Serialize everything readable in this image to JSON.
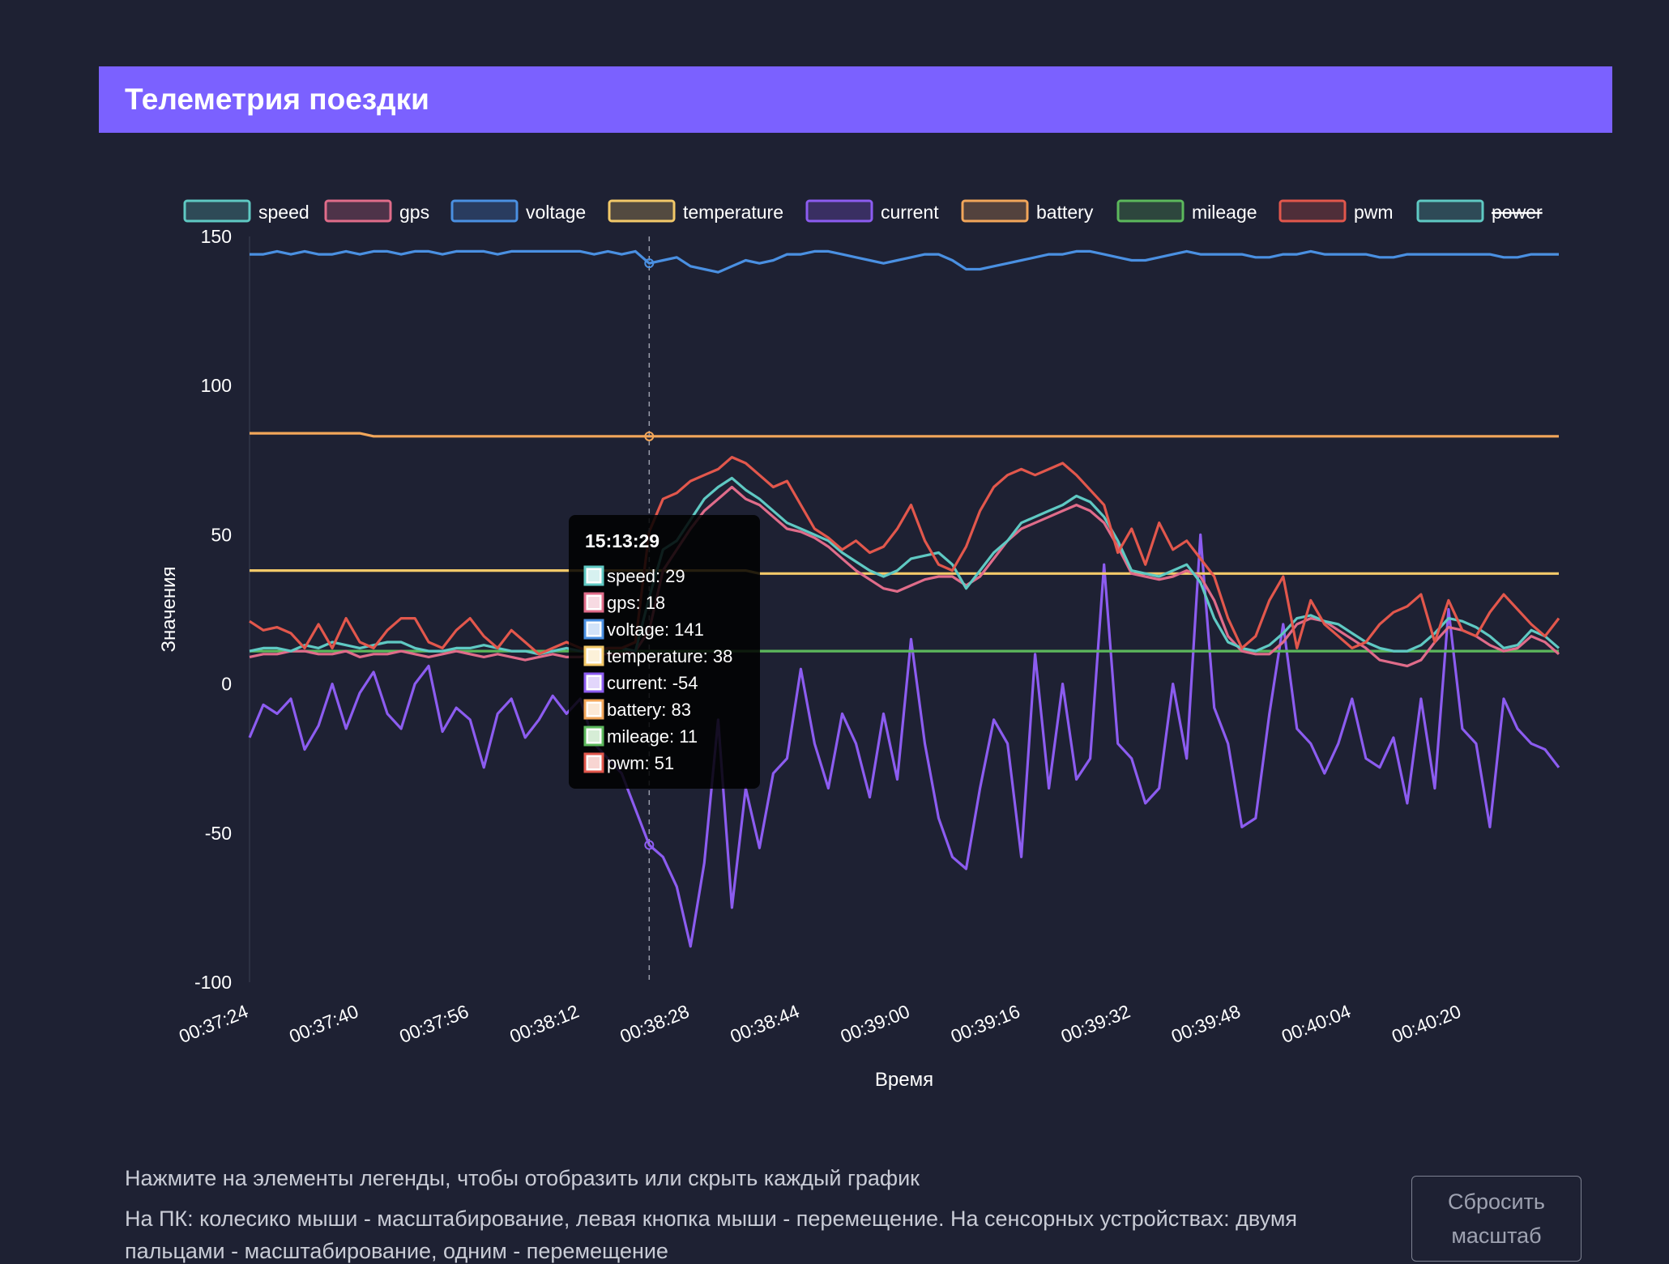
{
  "header": {
    "title": "Телеметрия поездки"
  },
  "hints": {
    "line1": "Нажмите на элементы легенды, чтобы отобразить или скрыть каждый график",
    "line2": "На ПК: колесико мыши - масштабирование, левая кнопка мыши - перемещение. На сенсорных устройствах: двумя",
    "line3": "пальцами - масштабирование, одним - перемещение"
  },
  "reset_button": {
    "label": "Сбросить масштаб"
  },
  "tooltip": {
    "time": "15:13:29",
    "rows": [
      {
        "series": "speed",
        "text": "speed: 29"
      },
      {
        "series": "gps",
        "text": "gps: 18"
      },
      {
        "series": "voltage",
        "text": "voltage: 141"
      },
      {
        "series": "temperature",
        "text": "temperature: 38"
      },
      {
        "series": "current",
        "text": "current: -54"
      },
      {
        "series": "battery",
        "text": "battery: 83"
      },
      {
        "series": "mileage",
        "text": "mileage: 11"
      },
      {
        "series": "pwm",
        "text": "pwm: 51"
      }
    ]
  },
  "chart_data": {
    "type": "line",
    "xlabel": "Время",
    "ylabel": "Значения",
    "ylim": [
      -100,
      150
    ],
    "yticks": [
      150,
      100,
      50,
      0,
      -50,
      -100
    ],
    "xlim": [
      "00:37:24",
      "00:40:34"
    ],
    "xticks": [
      "00:37:24",
      "00:37:40",
      "00:37:56",
      "00:38:12",
      "00:38:28",
      "00:38:44",
      "00:39:00",
      "00:39:16",
      "00:39:32",
      "00:39:48",
      "00:40:04",
      "00:40:20"
    ],
    "grid": false,
    "legend_position": "top",
    "hover_time": "00:38:22",
    "x": [
      "00:37:24",
      "00:37:26",
      "00:37:28",
      "00:37:30",
      "00:37:32",
      "00:37:34",
      "00:37:36",
      "00:37:38",
      "00:37:40",
      "00:37:42",
      "00:37:44",
      "00:37:46",
      "00:37:48",
      "00:37:50",
      "00:37:52",
      "00:37:54",
      "00:37:56",
      "00:37:58",
      "00:38:00",
      "00:38:02",
      "00:38:04",
      "00:38:06",
      "00:38:08",
      "00:38:10",
      "00:38:12",
      "00:38:14",
      "00:38:16",
      "00:38:18",
      "00:38:20",
      "00:38:22",
      "00:38:24",
      "00:38:26",
      "00:38:28",
      "00:38:30",
      "00:38:32",
      "00:38:34",
      "00:38:36",
      "00:38:38",
      "00:38:40",
      "00:38:42",
      "00:38:44",
      "00:38:46",
      "00:38:48",
      "00:38:50",
      "00:38:52",
      "00:38:54",
      "00:38:56",
      "00:38:58",
      "00:39:00",
      "00:39:02",
      "00:39:04",
      "00:39:06",
      "00:39:08",
      "00:39:10",
      "00:39:12",
      "00:39:14",
      "00:39:16",
      "00:39:18",
      "00:39:20",
      "00:39:22",
      "00:39:24",
      "00:39:26",
      "00:39:28",
      "00:39:30",
      "00:39:32",
      "00:39:34",
      "00:39:36",
      "00:39:38",
      "00:39:40",
      "00:39:42",
      "00:39:44",
      "00:39:46",
      "00:39:48",
      "00:39:50",
      "00:39:52",
      "00:39:54",
      "00:39:56",
      "00:39:58",
      "00:40:00",
      "00:40:02",
      "00:40:04",
      "00:40:06",
      "00:40:08",
      "00:40:10",
      "00:40:12",
      "00:40:14",
      "00:40:16",
      "00:40:18",
      "00:40:20",
      "00:40:22",
      "00:40:24",
      "00:40:26",
      "00:40:28",
      "00:40:30",
      "00:40:32",
      "00:40:34"
    ],
    "series": [
      {
        "name": "speed",
        "color": "#5fc9c3",
        "fill": "rgba(95,201,195,0.25)",
        "hidden": false,
        "values": [
          11,
          12,
          12,
          11,
          13,
          12,
          14,
          13,
          12,
          13,
          14,
          14,
          12,
          11,
          11,
          12,
          12,
          13,
          12,
          11,
          11,
          10,
          11,
          12,
          11,
          11,
          12,
          12,
          11,
          29,
          45,
          48,
          55,
          62,
          66,
          69,
          65,
          62,
          58,
          54,
          52,
          50,
          48,
          44,
          41,
          38,
          36,
          38,
          42,
          43,
          44,
          40,
          32,
          38,
          44,
          48,
          54,
          56,
          58,
          60,
          63,
          61,
          56,
          48,
          38,
          37,
          36,
          38,
          40,
          34,
          22,
          14,
          12,
          11,
          13,
          17,
          22,
          23,
          21,
          20,
          17,
          14,
          12,
          11,
          11,
          13,
          17,
          22,
          21,
          19,
          16,
          12,
          13,
          18,
          16,
          12
        ]
      },
      {
        "name": "gps",
        "color": "#e06c8a",
        "fill": "rgba(224,108,138,0.25)",
        "hidden": false,
        "values": [
          9,
          10,
          10,
          11,
          11,
          10,
          10,
          11,
          9,
          10,
          10,
          11,
          10,
          9,
          10,
          11,
          10,
          9,
          10,
          9,
          8,
          9,
          10,
          9,
          9,
          10,
          10,
          10,
          11,
          18,
          38,
          45,
          52,
          58,
          62,
          66,
          62,
          60,
          56,
          52,
          51,
          49,
          46,
          42,
          38,
          35,
          32,
          31,
          33,
          35,
          36,
          36,
          33,
          36,
          42,
          48,
          52,
          54,
          56,
          58,
          60,
          58,
          54,
          46,
          37,
          36,
          35,
          36,
          38,
          36,
          28,
          16,
          11,
          10,
          10,
          14,
          20,
          22,
          21,
          18,
          15,
          12,
          8,
          7,
          6,
          8,
          14,
          19,
          18,
          16,
          13,
          11,
          12,
          16,
          14,
          10
        ]
      },
      {
        "name": "voltage",
        "color": "#4a90e2",
        "fill": "rgba(74,144,226,0.25)",
        "hidden": false,
        "values": [
          144,
          144,
          145,
          144,
          145,
          144,
          144,
          145,
          144,
          145,
          145,
          144,
          145,
          145,
          144,
          145,
          145,
          145,
          144,
          145,
          145,
          145,
          145,
          145,
          145,
          144,
          145,
          144,
          145,
          141,
          142,
          143,
          140,
          139,
          138,
          140,
          142,
          141,
          142,
          144,
          144,
          145,
          145,
          144,
          143,
          142,
          141,
          142,
          143,
          144,
          144,
          142,
          139,
          139,
          140,
          141,
          142,
          143,
          144,
          144,
          145,
          145,
          144,
          143,
          142,
          142,
          143,
          144,
          145,
          144,
          144,
          144,
          144,
          143,
          143,
          144,
          144,
          145,
          144,
          144,
          144,
          144,
          143,
          143,
          144,
          144,
          144,
          144,
          144,
          144,
          144,
          143,
          143,
          144,
          144,
          144
        ]
      },
      {
        "name": "temperature",
        "color": "#f3c969",
        "fill": "rgba(243,201,105,0.25)",
        "hidden": false,
        "values": [
          38,
          38,
          38,
          38,
          38,
          38,
          38,
          38,
          38,
          38,
          38,
          38,
          38,
          38,
          38,
          38,
          38,
          38,
          38,
          38,
          38,
          38,
          38,
          38,
          38,
          38,
          38,
          38,
          38,
          38,
          38,
          38,
          38,
          38,
          38,
          38,
          38,
          37,
          37,
          37,
          37,
          37,
          37,
          37,
          37,
          37,
          37,
          37,
          37,
          37,
          37,
          37,
          37,
          37,
          37,
          37,
          37,
          37,
          37,
          37,
          37,
          37,
          37,
          37,
          37,
          37,
          37,
          37,
          37,
          37,
          37,
          37,
          37,
          37,
          37,
          37,
          37,
          37,
          37,
          37,
          37,
          37,
          37,
          37,
          37,
          37,
          37,
          37,
          37,
          37,
          37,
          37,
          37,
          37,
          37,
          37
        ]
      },
      {
        "name": "current",
        "color": "#8c5cf0",
        "fill": "rgba(140,92,240,0.25)",
        "hidden": false,
        "values": [
          -18,
          -7,
          -10,
          -5,
          -22,
          -14,
          0,
          -15,
          -3,
          4,
          -10,
          -15,
          0,
          6,
          -16,
          -8,
          -12,
          -28,
          -10,
          -5,
          -18,
          -12,
          -4,
          -10,
          -5,
          -20,
          -25,
          -30,
          -42,
          -54,
          -58,
          -68,
          -88,
          -60,
          -12,
          -75,
          -35,
          -55,
          -30,
          -25,
          5,
          -20,
          -35,
          -10,
          -20,
          -38,
          -10,
          -32,
          15,
          -20,
          -45,
          -58,
          -62,
          -35,
          -12,
          -20,
          -58,
          10,
          -35,
          0,
          -32,
          -25,
          40,
          -20,
          -25,
          -40,
          -35,
          0,
          -25,
          50,
          -8,
          -20,
          -48,
          -45,
          -10,
          20,
          -15,
          -20,
          -30,
          -20,
          -5,
          -25,
          -28,
          -18,
          -40,
          -5,
          -35,
          25,
          -15,
          -20,
          -48,
          -5,
          -15,
          -20,
          -22,
          -28
        ]
      },
      {
        "name": "battery",
        "color": "#f2a65a",
        "fill": "rgba(242,166,90,0.25)",
        "hidden": false,
        "values": [
          84,
          84,
          84,
          84,
          84,
          84,
          84,
          84,
          84,
          83,
          83,
          83,
          83,
          83,
          83,
          83,
          83,
          83,
          83,
          83,
          83,
          83,
          83,
          83,
          83,
          83,
          83,
          83,
          83,
          83,
          83,
          83,
          83,
          83,
          83,
          83,
          83,
          83,
          83,
          83,
          83,
          83,
          83,
          83,
          83,
          83,
          83,
          83,
          83,
          83,
          83,
          83,
          83,
          83,
          83,
          83,
          83,
          83,
          83,
          83,
          83,
          83,
          83,
          83,
          83,
          83,
          83,
          83,
          83,
          83,
          83,
          83,
          83,
          83,
          83,
          83,
          83,
          83,
          83,
          83,
          83,
          83,
          83,
          83,
          83,
          83,
          83,
          83,
          83,
          83,
          83,
          83,
          83,
          83,
          83,
          83
        ]
      },
      {
        "name": "mileage",
        "color": "#5cb85c",
        "fill": "rgba(92,184,92,0.25)",
        "hidden": false,
        "values": [
          11,
          11,
          11,
          11,
          11,
          11,
          11,
          11,
          11,
          11,
          11,
          11,
          11,
          11,
          11,
          11,
          11,
          11,
          11,
          11,
          11,
          11,
          11,
          11,
          11,
          11,
          11,
          11,
          11,
          11,
          11,
          11,
          11,
          11,
          11,
          11,
          11,
          11,
          11,
          11,
          11,
          11,
          11,
          11,
          11,
          11,
          11,
          11,
          11,
          11,
          11,
          11,
          11,
          11,
          11,
          11,
          11,
          11,
          11,
          11,
          11,
          11,
          11,
          11,
          11,
          11,
          11,
          11,
          11,
          11,
          11,
          11,
          11,
          11,
          11,
          11,
          11,
          11,
          11,
          11,
          11,
          11,
          11,
          11,
          11,
          11,
          11,
          11,
          11,
          11,
          11,
          11,
          11,
          11,
          11,
          11
        ]
      },
      {
        "name": "pwm",
        "color": "#e2574c",
        "fill": "rgba(226,87,76,0.25)",
        "hidden": false,
        "values": [
          21,
          18,
          19,
          17,
          12,
          20,
          12,
          22,
          14,
          12,
          18,
          22,
          22,
          14,
          12,
          18,
          22,
          16,
          12,
          18,
          14,
          10,
          12,
          14,
          12,
          11,
          12,
          12,
          14,
          51,
          62,
          64,
          68,
          70,
          72,
          76,
          74,
          70,
          66,
          68,
          60,
          52,
          49,
          45,
          48,
          44,
          46,
          52,
          60,
          48,
          40,
          38,
          46,
          58,
          66,
          70,
          72,
          70,
          72,
          74,
          70,
          65,
          60,
          44,
          52,
          40,
          54,
          45,
          48,
          42,
          36,
          22,
          12,
          16,
          28,
          36,
          12,
          28,
          20,
          16,
          12,
          14,
          20,
          24,
          26,
          30,
          14,
          28,
          18,
          16,
          24,
          30,
          25,
          20,
          16,
          22
        ]
      },
      {
        "name": "power",
        "color": "#5fc9c3",
        "fill": "rgba(95,201,195,0.25)",
        "hidden": true,
        "values": []
      }
    ]
  }
}
